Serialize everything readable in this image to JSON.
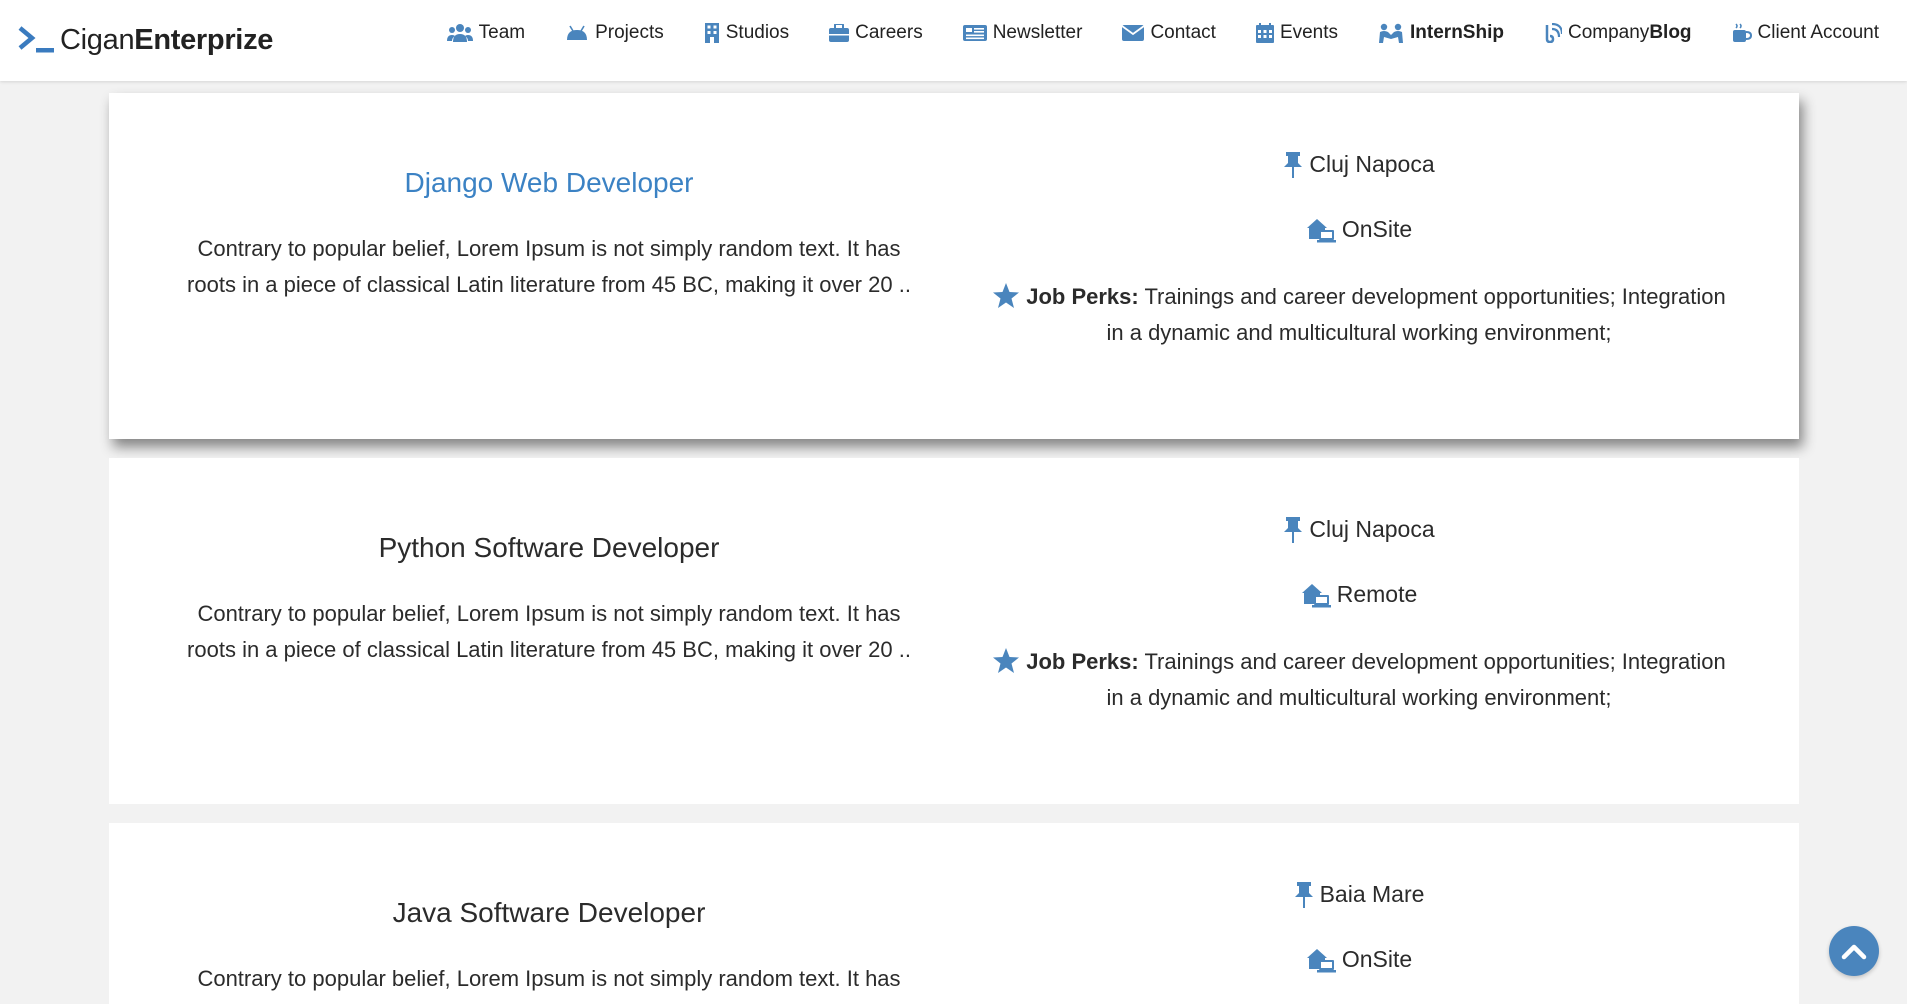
{
  "brand": {
    "prefix": "Cigan",
    "suffix": "Enterprize"
  },
  "nav": [
    {
      "label": "Team",
      "icon": "team-icon"
    },
    {
      "label": "Projects",
      "icon": "android-icon"
    },
    {
      "label": "Studios",
      "icon": "building-icon"
    },
    {
      "label": "Careers",
      "icon": "briefcase-icon"
    },
    {
      "label": "Newsletter",
      "icon": "newspaper-icon"
    },
    {
      "label": "Contact",
      "icon": "envelope-icon"
    },
    {
      "label": "Events",
      "icon": "calendar-icon"
    },
    {
      "label": "InternShip",
      "icon": "people-icon"
    },
    {
      "label_regular": "Company",
      "label_bold": "Blog",
      "icon": "blog-icon"
    },
    {
      "label": "Client Account",
      "icon": "coffee-icon"
    }
  ],
  "jobs": [
    {
      "title": "Django Web Developer",
      "desc_line1": "Contrary to popular belief, Lorem Ipsum is not simply random text. It has",
      "desc_line2": "roots in a piece of classical Latin literature from 45 BC, making it over 20 ..",
      "location": "Cluj Napoca",
      "work_type": "OnSite",
      "perks_label": "Job Perks:",
      "perks_line1": "Trainings and career development opportunities; Integration",
      "perks_line2": "in a dynamic and multicultural working environment;"
    },
    {
      "title": "Python Software Developer",
      "desc_line1": "Contrary to popular belief, Lorem Ipsum is not simply random text. It has",
      "desc_line2": "roots in a piece of classical Latin literature from 45 BC, making it over 20 ..",
      "location": "Cluj Napoca",
      "work_type": "Remote",
      "perks_label": "Job Perks:",
      "perks_line1": "Trainings and career development opportunities; Integration",
      "perks_line2": "in a dynamic and multicultural working environment;"
    },
    {
      "title": "Java Software Developer",
      "desc_line1": "Contrary to popular belief, Lorem Ipsum is not simply random text. It has",
      "location": "Baia Mare",
      "work_type": "OnSite"
    }
  ],
  "colors": {
    "accent": "#4a85bd",
    "link": "#3b82c4",
    "background": "#f2f2f2"
  }
}
